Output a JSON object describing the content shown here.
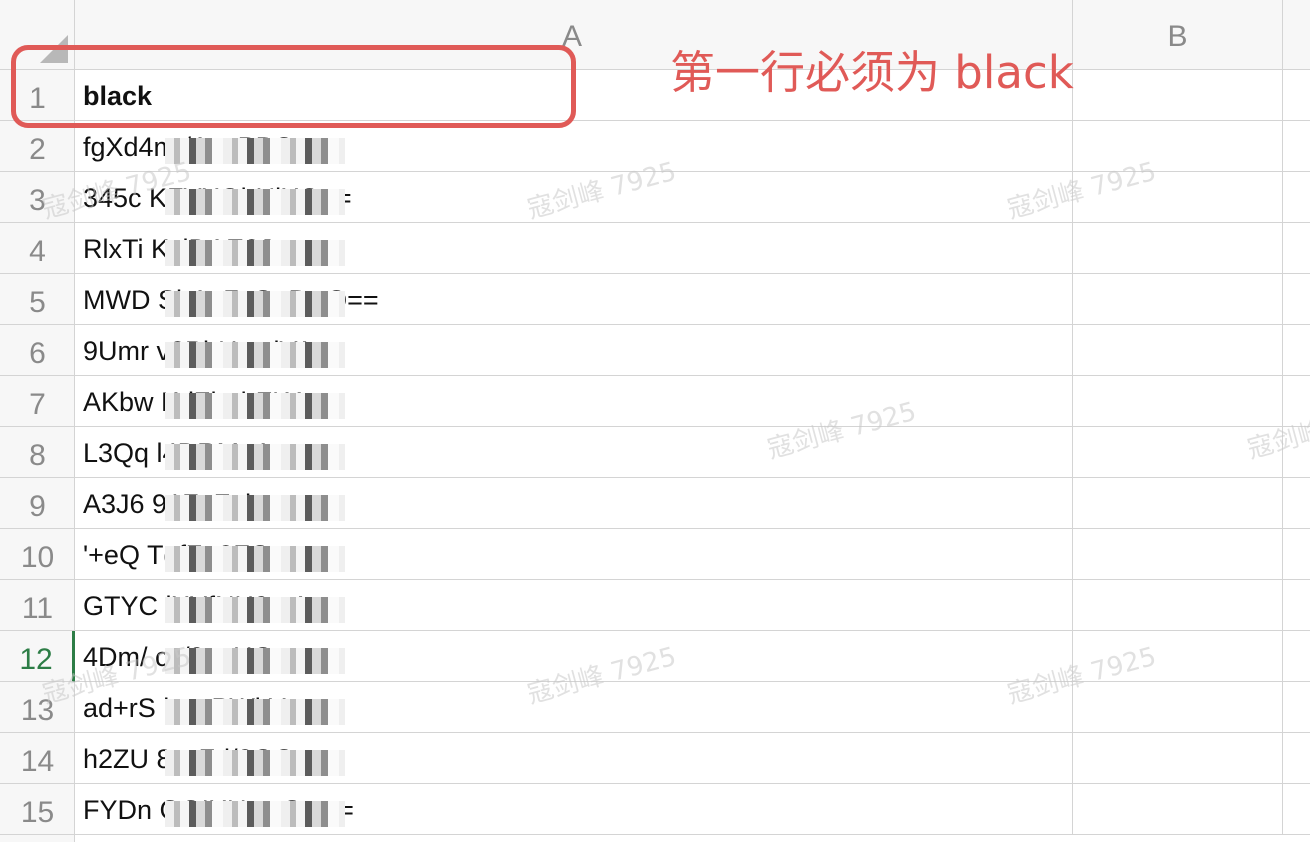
{
  "sheet": {
    "columns": [
      "A",
      "B",
      ""
    ],
    "rows": [
      {
        "num": "1",
        "value": "black"
      },
      {
        "num": "2",
        "value": "fgXd4m                 /AasPBCw=="
      },
      {
        "num": "3",
        "value": "345c                   KFVXQhUjXQ=="
      },
      {
        "num": "4",
        "value": "RlxTi                  KvlDAE2Jw=="
      },
      {
        "num": "5",
        "value": "MWD                    SbAp7xGnBwQ=="
      },
      {
        "num": "6",
        "value": "9Umr                   v3PbHzmjVA=="
      },
      {
        "num": "7",
        "value": "AKbw                   KdZhnhFKA=="
      },
      {
        "num": "8",
        "value": "L3Qq                   l4DRMnA=="
      },
      {
        "num": "9",
        "value": "A3J6                   91FnFuisw=="
      },
      {
        "num": "10",
        "value": "'+eQ                   TqfZ+3FQ=="
      },
      {
        "num": "11",
        "value": "GTYC                   lXYfNH9mA=="
      },
      {
        "num": "12",
        "value": "4Dm/                   cv/9vaHQ=="
      },
      {
        "num": "13",
        "value": "ad+rS                  lpycPWkYg=="
      },
      {
        "num": "14",
        "value": "h2ZU                   8vcFd/3OQ=="
      },
      {
        "num": "15",
        "value": "FYDn                   GOIXUw+Ow=="
      }
    ],
    "active_row": "12"
  },
  "annotation": {
    "text": "第一行必须为 black",
    "color": "#e05a57"
  },
  "watermark": {
    "text": "寇剑峰 7925"
  },
  "colors": {
    "header_bg": "#f7f7f7",
    "grid_line": "#d4d4d4",
    "active_row_accent": "#2d7d46"
  }
}
